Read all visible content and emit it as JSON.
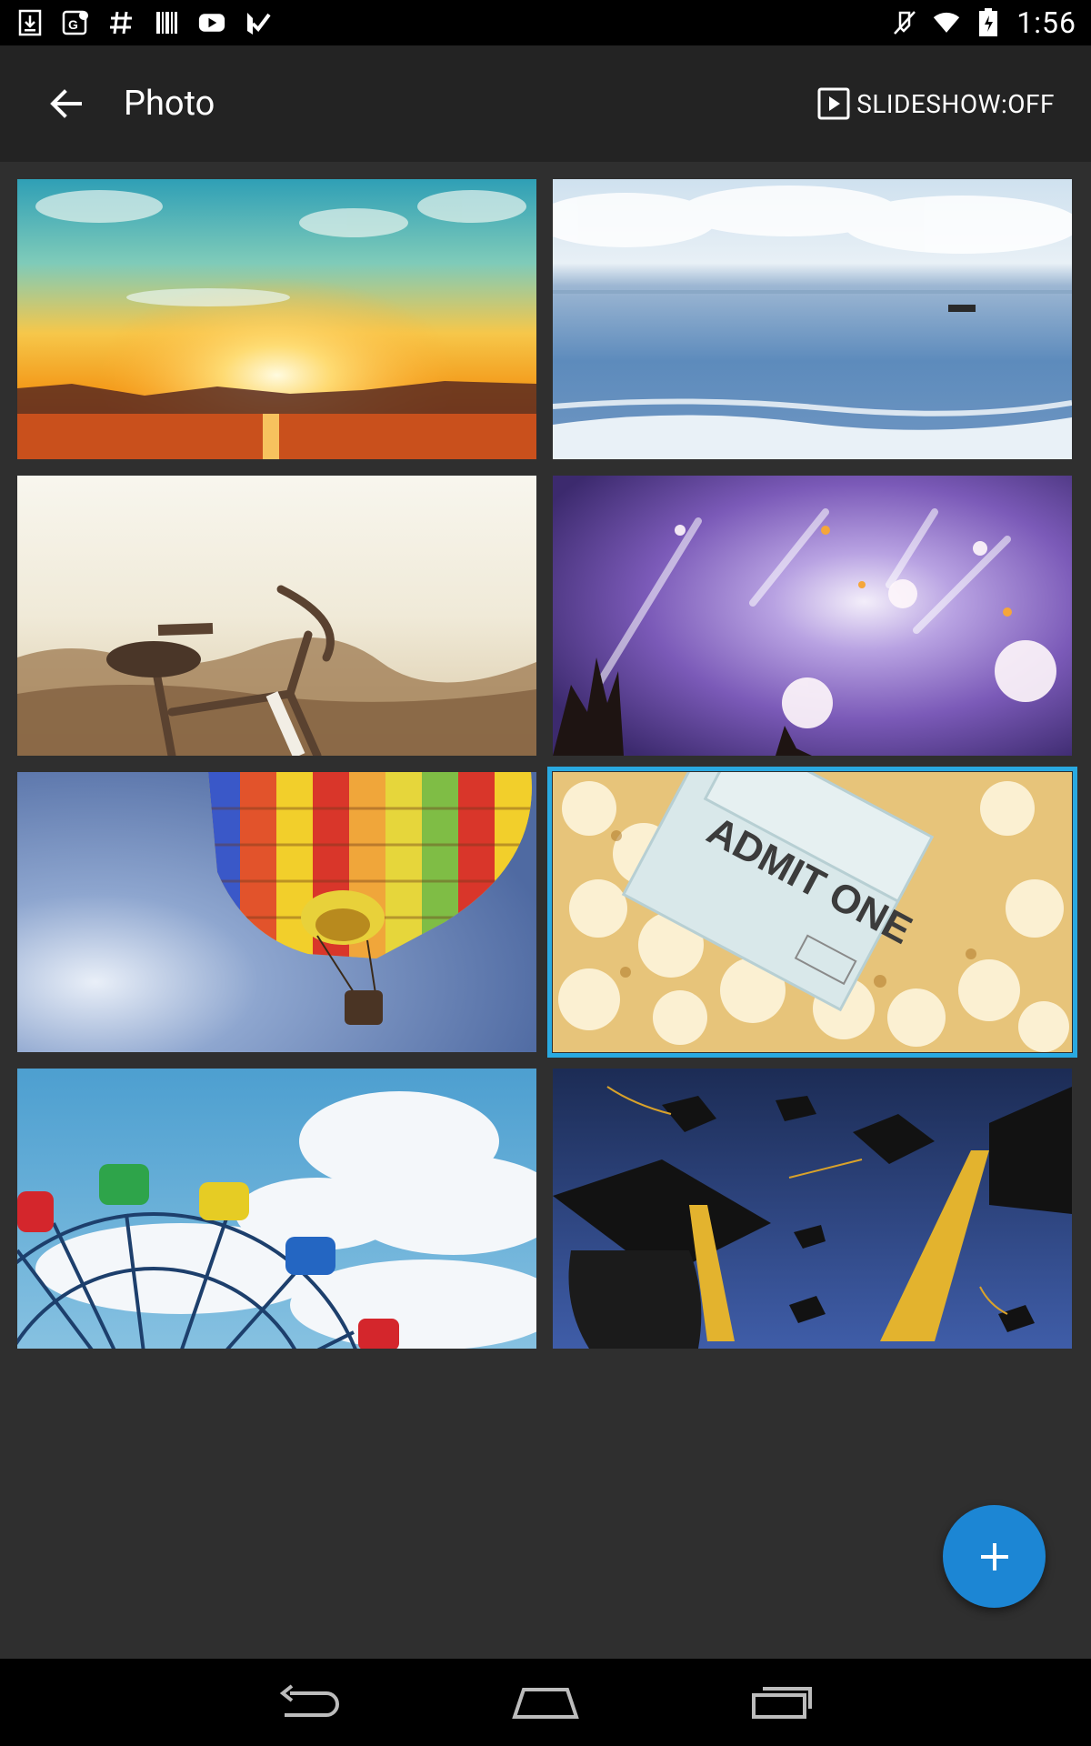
{
  "status_bar": {
    "time": "1:56",
    "left_icons": [
      "download-icon",
      "maps-icon",
      "hashtag-icon",
      "barcode-icon",
      "youtube-icon",
      "checkmark-icon"
    ],
    "right_icons": [
      "mute-icon",
      "wifi-icon",
      "battery-icon"
    ]
  },
  "toolbar": {
    "title": "Photo",
    "slideshow_label": "SLIDESHOW:OFF"
  },
  "photos": [
    {
      "subject": "sunset",
      "selected": false
    },
    {
      "subject": "ocean",
      "selected": false
    },
    {
      "subject": "bicycle",
      "selected": false
    },
    {
      "subject": "concert",
      "selected": false
    },
    {
      "subject": "hot-air-balloon",
      "selected": false
    },
    {
      "subject": "popcorn-ticket",
      "selected": true,
      "ticket_text": "ADMIT ONE"
    },
    {
      "subject": "ferris-wheel",
      "selected": false
    },
    {
      "subject": "graduation-caps",
      "selected": false
    }
  ],
  "fab": {
    "icon": "plus-icon"
  },
  "nav_bar": {
    "icons": [
      "back-nav-icon",
      "home-nav-icon",
      "recents-nav-icon"
    ]
  },
  "colors": {
    "accent": "#29a9e1",
    "fab": "#1c86d4",
    "background": "#2f2f2f",
    "toolbar": "#232323"
  }
}
